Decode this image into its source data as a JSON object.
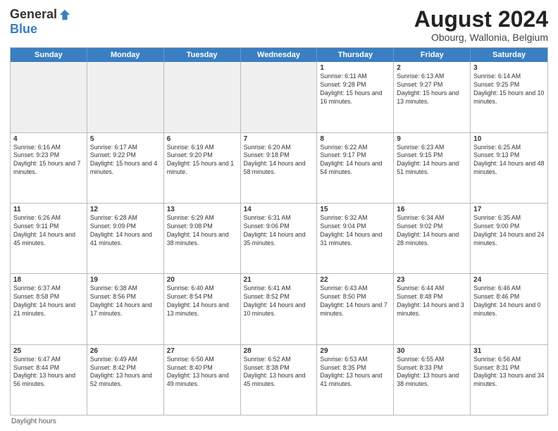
{
  "logo": {
    "general": "General",
    "blue": "Blue"
  },
  "title": "August 2024",
  "subtitle": "Obourg, Wallonia, Belgium",
  "days": [
    "Sunday",
    "Monday",
    "Tuesday",
    "Wednesday",
    "Thursday",
    "Friday",
    "Saturday"
  ],
  "weeks": [
    [
      {
        "day": "",
        "info": "",
        "shaded": true
      },
      {
        "day": "",
        "info": "",
        "shaded": true
      },
      {
        "day": "",
        "info": "",
        "shaded": true
      },
      {
        "day": "",
        "info": "",
        "shaded": true
      },
      {
        "day": "1",
        "info": "Sunrise: 6:11 AM\nSunset: 9:28 PM\nDaylight: 15 hours and 16 minutes."
      },
      {
        "day": "2",
        "info": "Sunrise: 6:13 AM\nSunset: 9:27 PM\nDaylight: 15 hours and 13 minutes."
      },
      {
        "day": "3",
        "info": "Sunrise: 6:14 AM\nSunset: 9:25 PM\nDaylight: 15 hours and 10 minutes."
      }
    ],
    [
      {
        "day": "4",
        "info": "Sunrise: 6:16 AM\nSunset: 9:23 PM\nDaylight: 15 hours and 7 minutes."
      },
      {
        "day": "5",
        "info": "Sunrise: 6:17 AM\nSunset: 9:22 PM\nDaylight: 15 hours and 4 minutes."
      },
      {
        "day": "6",
        "info": "Sunrise: 6:19 AM\nSunset: 9:20 PM\nDaylight: 15 hours and 1 minute."
      },
      {
        "day": "7",
        "info": "Sunrise: 6:20 AM\nSunset: 9:18 PM\nDaylight: 14 hours and 58 minutes."
      },
      {
        "day": "8",
        "info": "Sunrise: 6:22 AM\nSunset: 9:17 PM\nDaylight: 14 hours and 54 minutes."
      },
      {
        "day": "9",
        "info": "Sunrise: 6:23 AM\nSunset: 9:15 PM\nDaylight: 14 hours and 51 minutes."
      },
      {
        "day": "10",
        "info": "Sunrise: 6:25 AM\nSunset: 9:13 PM\nDaylight: 14 hours and 48 minutes."
      }
    ],
    [
      {
        "day": "11",
        "info": "Sunrise: 6:26 AM\nSunset: 9:11 PM\nDaylight: 14 hours and 45 minutes."
      },
      {
        "day": "12",
        "info": "Sunrise: 6:28 AM\nSunset: 9:09 PM\nDaylight: 14 hours and 41 minutes."
      },
      {
        "day": "13",
        "info": "Sunrise: 6:29 AM\nSunset: 9:08 PM\nDaylight: 14 hours and 38 minutes."
      },
      {
        "day": "14",
        "info": "Sunrise: 6:31 AM\nSunset: 9:06 PM\nDaylight: 14 hours and 35 minutes."
      },
      {
        "day": "15",
        "info": "Sunrise: 6:32 AM\nSunset: 9:04 PM\nDaylight: 14 hours and 31 minutes."
      },
      {
        "day": "16",
        "info": "Sunrise: 6:34 AM\nSunset: 9:02 PM\nDaylight: 14 hours and 28 minutes."
      },
      {
        "day": "17",
        "info": "Sunrise: 6:35 AM\nSunset: 9:00 PM\nDaylight: 14 hours and 24 minutes."
      }
    ],
    [
      {
        "day": "18",
        "info": "Sunrise: 6:37 AM\nSunset: 8:58 PM\nDaylight: 14 hours and 21 minutes."
      },
      {
        "day": "19",
        "info": "Sunrise: 6:38 AM\nSunset: 8:56 PM\nDaylight: 14 hours and 17 minutes."
      },
      {
        "day": "20",
        "info": "Sunrise: 6:40 AM\nSunset: 8:54 PM\nDaylight: 14 hours and 13 minutes."
      },
      {
        "day": "21",
        "info": "Sunrise: 6:41 AM\nSunset: 8:52 PM\nDaylight: 14 hours and 10 minutes."
      },
      {
        "day": "22",
        "info": "Sunrise: 6:43 AM\nSunset: 8:50 PM\nDaylight: 14 hours and 7 minutes."
      },
      {
        "day": "23",
        "info": "Sunrise: 6:44 AM\nSunset: 8:48 PM\nDaylight: 14 hours and 3 minutes."
      },
      {
        "day": "24",
        "info": "Sunrise: 6:46 AM\nSunset: 8:46 PM\nDaylight: 14 hours and 0 minutes."
      }
    ],
    [
      {
        "day": "25",
        "info": "Sunrise: 6:47 AM\nSunset: 8:44 PM\nDaylight: 13 hours and 56 minutes."
      },
      {
        "day": "26",
        "info": "Sunrise: 6:49 AM\nSunset: 8:42 PM\nDaylight: 13 hours and 52 minutes."
      },
      {
        "day": "27",
        "info": "Sunrise: 6:50 AM\nSunset: 8:40 PM\nDaylight: 13 hours and 49 minutes."
      },
      {
        "day": "28",
        "info": "Sunrise: 6:52 AM\nSunset: 8:38 PM\nDaylight: 13 hours and 45 minutes."
      },
      {
        "day": "29",
        "info": "Sunrise: 6:53 AM\nSunset: 8:35 PM\nDaylight: 13 hours and 41 minutes."
      },
      {
        "day": "30",
        "info": "Sunrise: 6:55 AM\nSunset: 8:33 PM\nDaylight: 13 hours and 38 minutes."
      },
      {
        "day": "31",
        "info": "Sunrise: 6:56 AM\nSunset: 8:31 PM\nDaylight: 13 hours and 34 minutes."
      }
    ]
  ],
  "footer": "Daylight hours"
}
